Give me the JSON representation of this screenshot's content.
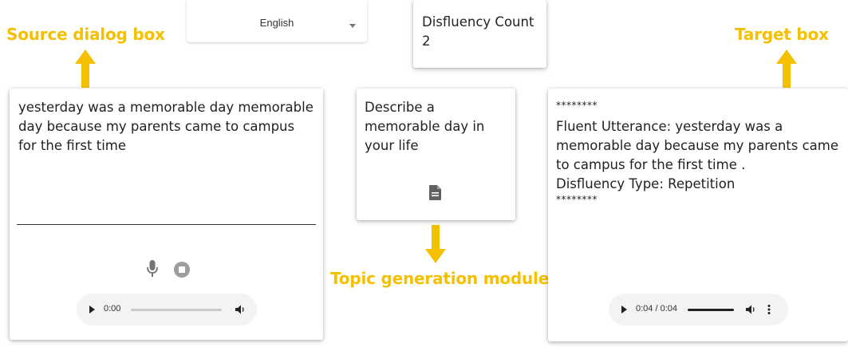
{
  "annotations": {
    "source_label": "Source dialog box",
    "target_label": "Target box",
    "topic_label": "Topic generation module"
  },
  "language_select": {
    "value": "English"
  },
  "disfluency": {
    "label": "Disfluency Count",
    "count": "2"
  },
  "source": {
    "transcript": "yesterday was a memorable day memorable day because my parents came to campus for the first time",
    "audio": {
      "time": "0:00",
      "progress": 0
    }
  },
  "topic": {
    "prompt": "Describe a memorable day in your life"
  },
  "target": {
    "stars_top": "********",
    "fluent_utterance": "Fluent Utterance: yesterday was a memorable day because my parents came to campus for the first time .",
    "disfluency_type": "Disfluency Type: Repetition",
    "stars_bottom": "********",
    "audio": {
      "time": "0:04 / 0:04",
      "progress": 1.0
    }
  },
  "colors": {
    "annotation": "#f5c000"
  },
  "icons": [
    "microphone-icon",
    "stop-icon",
    "document-icon",
    "play-icon",
    "volume-icon",
    "more-options-icon",
    "dropdown-caret-icon",
    "arrow-up-icon",
    "arrow-down-icon"
  ]
}
